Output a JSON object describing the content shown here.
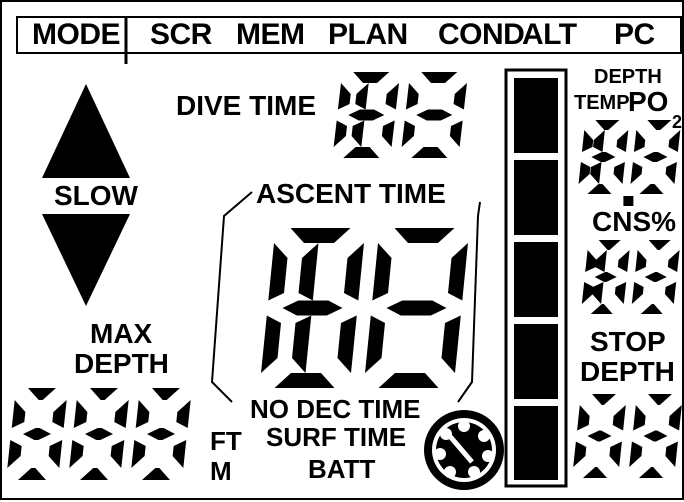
{
  "menu": {
    "items": [
      "MODE",
      "SCR",
      "MEM",
      "PLAN",
      "COND",
      "ALT",
      "PC"
    ]
  },
  "labels": {
    "dive_time": "DIVE TIME",
    "slow": "SLOW",
    "ascent_time": "ASCENT TIME",
    "max_depth_line1": "MAX",
    "max_depth_line2": "DEPTH",
    "no_dec_time": "NO DEC TIME",
    "surf_time": "SURF TIME",
    "batt": "BATT",
    "ft": "FT",
    "m": "M",
    "depth_small": "DEPTH",
    "temp": "TEMP",
    "po": "PO",
    "po_sub": "2",
    "cns": "CNS%",
    "stop": "STOP",
    "stop_depth": "DEPTH"
  },
  "digits": {
    "dive_time": "188",
    "ascent_time": "188",
    "max_depth": "888",
    "depth_temp": "18.8",
    "cns": "188",
    "stop_depth": "88"
  },
  "colors": {
    "segment": "#000000",
    "background": "#ffffff"
  },
  "icons": {
    "ascent_up": "triangle-up-icon",
    "ascent_down": "triangle-down-icon",
    "dive_gauge": "dive-gauge-icon"
  }
}
